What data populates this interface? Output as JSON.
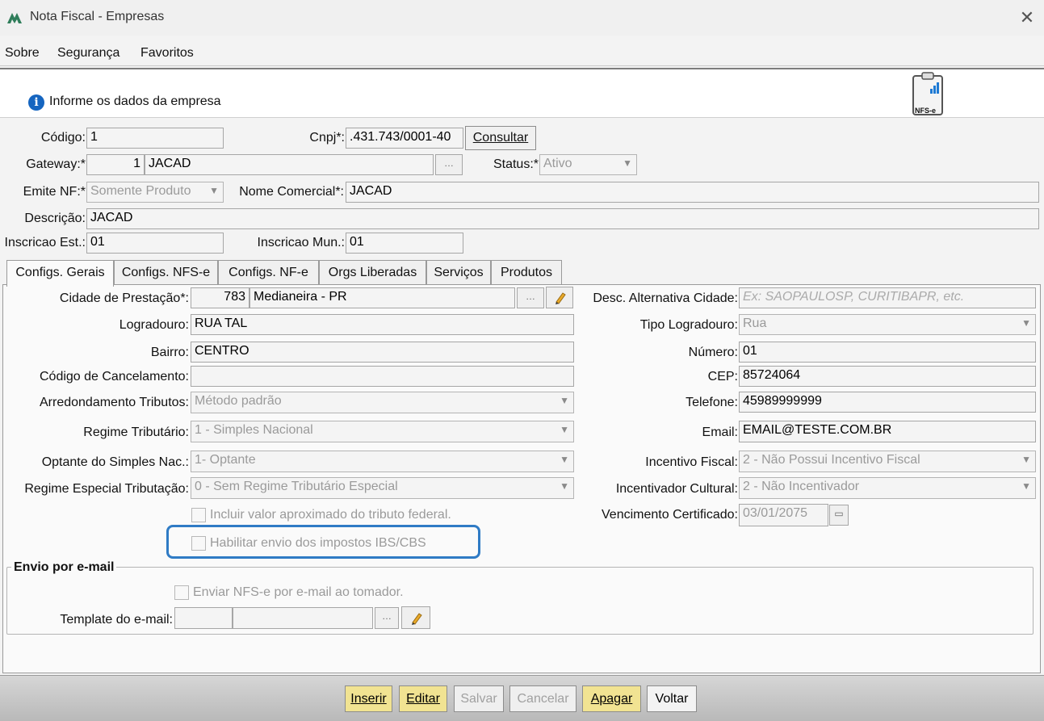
{
  "window": {
    "title": "Nota Fiscal - Empresas",
    "close_glyph": "✕"
  },
  "menu": {
    "items": [
      "Sobre",
      "Segurança",
      "Favoritos"
    ]
  },
  "header": {
    "info_text": "Informe os dados da empresa",
    "info_glyph": "i",
    "badge_text": "NFS-e"
  },
  "form": {
    "codigo_label": "Código:",
    "codigo_value": "1",
    "cnpj_label": "Cnpj*:",
    "cnpj_value": ".431.743/0001-40",
    "consultar_label": "Consultar",
    "gateway_label": "Gateway:*",
    "gateway_code": "1",
    "gateway_name": "JACAD",
    "status_label": "Status:*",
    "status_value": "Ativo",
    "emite_label": "Emite NF:*",
    "emite_value": "Somente Produto",
    "nome_comercial_label": "Nome Comercial*:",
    "nome_comercial_value": "JACAD",
    "descricao_label": "Descrição:",
    "descricao_value": "JACAD",
    "inscricao_est_label": "Inscricao Est.:",
    "inscricao_est_value": "01",
    "inscricao_mun_label": "Inscricao Mun.:",
    "inscricao_mun_value": "01"
  },
  "tabs": [
    "Configs. Gerais",
    "Configs. NFS-e",
    "Configs. NF-e",
    "Orgs Liberadas",
    "Serviços",
    "Produtos"
  ],
  "gerais": {
    "cidade_label": "Cidade de Prestação*:",
    "cidade_code": "783",
    "cidade_name": "Medianeira - PR",
    "desc_alt_label": "Desc. Alternativa Cidade:",
    "desc_alt_placeholder": "Ex: SAOPAULOSP, CURITIBAPR, etc.",
    "logradouro_label": "Logradouro:",
    "logradouro_value": "RUA TAL",
    "tipo_logradouro_label": "Tipo Logradouro:",
    "tipo_logradouro_value": "Rua",
    "bairro_label": "Bairro:",
    "bairro_value": "CENTRO",
    "numero_label": "Número:",
    "numero_value": "01",
    "cod_cancel_label": "Código de Cancelamento:",
    "cod_cancel_value": "",
    "cep_label": "CEP:",
    "cep_value": "85724064",
    "arred_label": "Arredondamento Tributos:",
    "arred_value": "Método padrão",
    "telefone_label": "Telefone:",
    "telefone_value": "45989999999",
    "regime_label": "Regime Tributário:",
    "regime_value": "1 - Simples Nacional",
    "email_label": "Email:",
    "email_value": "EMAIL@TESTE.COM.BR",
    "optante_label": "Optante do Simples Nac.:",
    "optante_value": "1- Optante",
    "incentivo_label": "Incentivo Fiscal:",
    "incentivo_value": "2 - Não Possui Incentivo Fiscal",
    "regime_esp_label": "Regime Especial Tributação:",
    "regime_esp_value": "0 - Sem Regime Tributário Especial",
    "incentivador_label": "Incentivador Cultural:",
    "incentivador_value": "2 - Não Incentivador",
    "incluir_label": "Incluir valor aproximado do tributo federal.",
    "vencimento_label": "Vencimento Certificado:",
    "vencimento_value": "03/01/2075",
    "habilitar_label": "Habilitar envio dos impostos IBS/CBS"
  },
  "email_group": {
    "title": "Envio por e-mail",
    "enviar_label": "Enviar NFS-e por e-mail ao tomador.",
    "template_label": "Template do e-mail:"
  },
  "footer": {
    "inserir": "Inserir",
    "editar": "Editar",
    "salvar": "Salvar",
    "cancelar": "Cancelar",
    "apagar": "Apagar",
    "voltar": "Voltar"
  },
  "colors": {
    "highlight": "#2f7bc5",
    "button_yellow": "#f1e392",
    "info_blue": "#1565c0"
  }
}
